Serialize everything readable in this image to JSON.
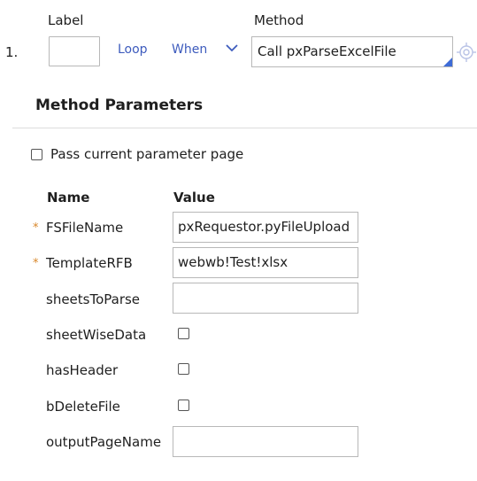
{
  "header": {
    "label_heading": "Label",
    "method_heading": "Method",
    "step_number": "1.",
    "loop_link": "Loop",
    "when_link": "When",
    "method_value": "Call pxParseExcelFile"
  },
  "section": {
    "title": "Method Parameters",
    "pass_current_label": "Pass current parameter page"
  },
  "table": {
    "name_header": "Name",
    "value_header": "Value",
    "rows": [
      {
        "name": "FSFileName",
        "required": "*",
        "value": "pxRequestor.pyFileUpload"
      },
      {
        "name": "TemplateRFB",
        "required": "*",
        "value": "webwb!Test!xlsx"
      },
      {
        "name": "sheetsToParse",
        "value": ""
      },
      {
        "name": "sheetWiseData"
      },
      {
        "name": "hasHeader"
      },
      {
        "name": "bDeleteFile"
      },
      {
        "name": "outputPageName",
        "value": ""
      }
    ]
  },
  "colors": {
    "link": "#3d5bbd",
    "required_star": "#d8872a",
    "accent_corner": "#3d6bd6"
  }
}
